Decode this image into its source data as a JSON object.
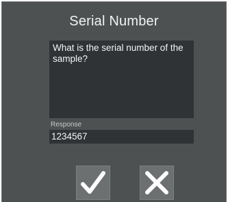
{
  "dialog": {
    "title": "Serial Number",
    "prompt": "What is the serial number of the sample?",
    "response_label": "Response",
    "response_value": "1234567"
  },
  "buttons": {
    "confirm_icon": "checkmark-icon",
    "cancel_icon": "close-icon"
  }
}
